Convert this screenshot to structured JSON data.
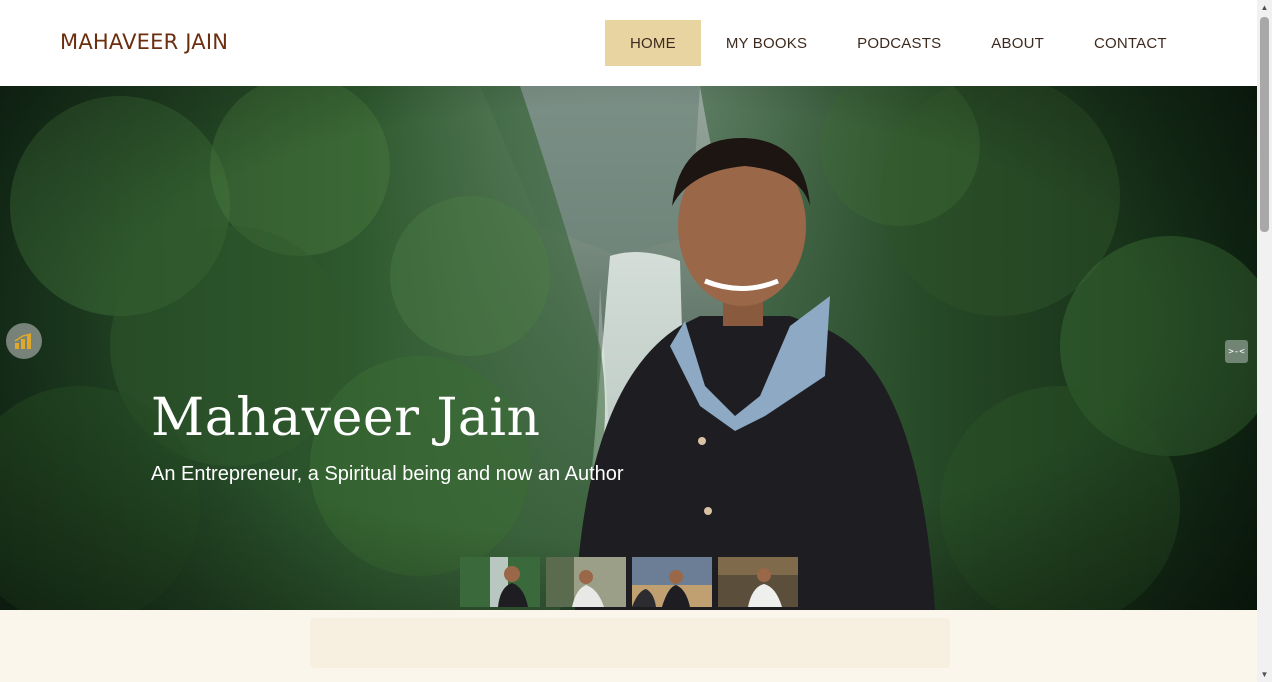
{
  "header": {
    "logo": "MAHAVEER JAIN",
    "nav": [
      {
        "label": "HOME",
        "active": true
      },
      {
        "label": "MY BOOKS",
        "active": false
      },
      {
        "label": "PODCASTS",
        "active": false
      },
      {
        "label": "ABOUT",
        "active": false
      },
      {
        "label": "CONTACT",
        "active": false
      }
    ]
  },
  "hero": {
    "title": "Mahaveer Jain",
    "subtitle": "An Entrepreneur, a Spiritual being and now an Author",
    "left_control_icon": "bar-chart-icon",
    "right_control_icon": "collapse-icon",
    "right_control_glyph": ">-<",
    "thumbnails_count": 4
  },
  "colors": {
    "brand": "#6b2e0e",
    "nav_active_bg": "#e8d4a1",
    "below_bg": "#faf6ec"
  }
}
